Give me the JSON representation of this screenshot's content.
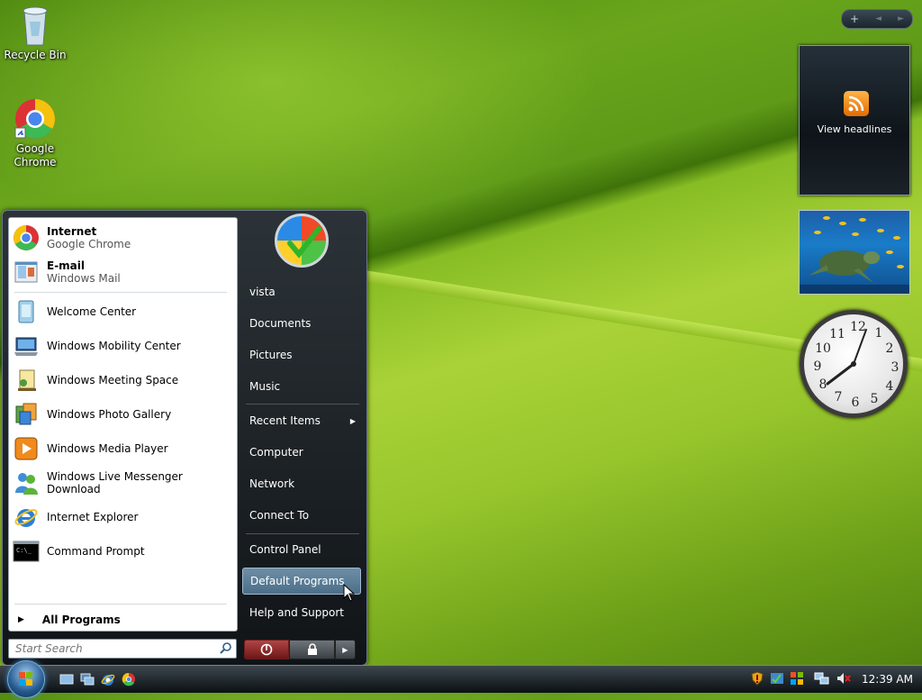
{
  "desktop": {
    "icons": [
      {
        "label": "Recycle Bin",
        "icon": "recycle-bin-icon"
      },
      {
        "label": "Google Chrome",
        "icon": "chrome-icon"
      }
    ]
  },
  "gadgets": {
    "controls": [
      "+",
      "◄",
      "►"
    ],
    "feed": {
      "label": "View headlines",
      "icon": "rss-icon"
    },
    "clock": {
      "numbers": [
        "12",
        "1",
        "2",
        "3",
        "4",
        "5",
        "6",
        "7",
        "8",
        "9",
        "10",
        "11"
      ]
    }
  },
  "start_menu": {
    "pinned": [
      {
        "title": "Internet",
        "subtitle": "Google Chrome",
        "icon": "chrome-icon"
      },
      {
        "title": "E-mail",
        "subtitle": "Windows Mail",
        "icon": "mail-icon"
      }
    ],
    "recent": [
      {
        "label": "Welcome Center",
        "icon": "welcome-center-icon"
      },
      {
        "label": "Windows Mobility Center",
        "icon": "mobility-center-icon"
      },
      {
        "label": "Windows Meeting Space",
        "icon": "meeting-space-icon"
      },
      {
        "label": "Windows Photo Gallery",
        "icon": "photo-gallery-icon"
      },
      {
        "label": "Windows Media Player",
        "icon": "media-player-icon"
      },
      {
        "label": "Windows Live Messenger Download",
        "icon": "messenger-icon"
      },
      {
        "label": "Internet Explorer",
        "icon": "internet-explorer-icon"
      },
      {
        "label": "Command Prompt",
        "icon": "command-prompt-icon"
      }
    ],
    "all_programs": "All Programs",
    "search_placeholder": "Start Search",
    "right": {
      "user": "vista",
      "items": [
        "Documents",
        "Pictures",
        "Music"
      ],
      "items2": [
        "Recent Items",
        "Computer",
        "Network",
        "Connect To"
      ],
      "items3": [
        "Control Panel",
        "Default Programs",
        "Help and Support"
      ],
      "highlighted": "Default Programs"
    }
  },
  "taskbar": {
    "time": "12:39 AM",
    "quick_launch": [
      "show-desktop-icon",
      "switch-windows-icon",
      "internet-explorer-icon",
      "chrome-icon"
    ],
    "tray": [
      "security-shield-icon",
      "network-icon",
      "volume-muted-icon"
    ]
  },
  "colors": {
    "highlight": "#5f82a0",
    "wallpaper": "#8bbf27"
  }
}
